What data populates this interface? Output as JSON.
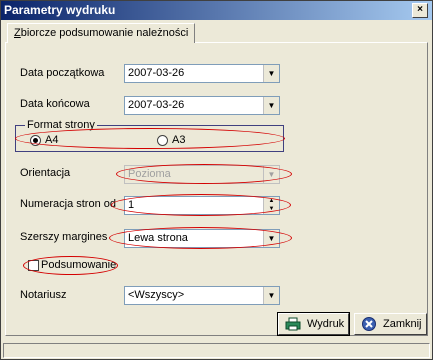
{
  "window": {
    "title": "Parametry wydruku",
    "close_label": "×"
  },
  "tab": {
    "label_first": "Z",
    "label_rest": "biorcze podsumowanie należności"
  },
  "fields": {
    "data_poczatkowa": {
      "label": "Data początkowa",
      "value": "2007-03-26"
    },
    "data_koncowa": {
      "label": "Data końcowa",
      "value": "2007-03-26"
    },
    "orientacja": {
      "label": "Orientacja",
      "value": "Pozioma"
    },
    "numeracja": {
      "label": "Numeracja stron od",
      "value": "1"
    },
    "margines": {
      "label": "Szerszy margines",
      "value": "Lewa strona"
    },
    "notariusz": {
      "label": "Notariusz",
      "value": "<Wszyscy>"
    }
  },
  "format": {
    "legend": "Format strony",
    "options": [
      {
        "label": "A4",
        "checked": true
      },
      {
        "label": "A3",
        "checked": false
      }
    ]
  },
  "podsumowanie": {
    "label": "Podsumowanie",
    "checked": false
  },
  "buttons": {
    "print": "Wydruk",
    "close": "Zamknij"
  }
}
